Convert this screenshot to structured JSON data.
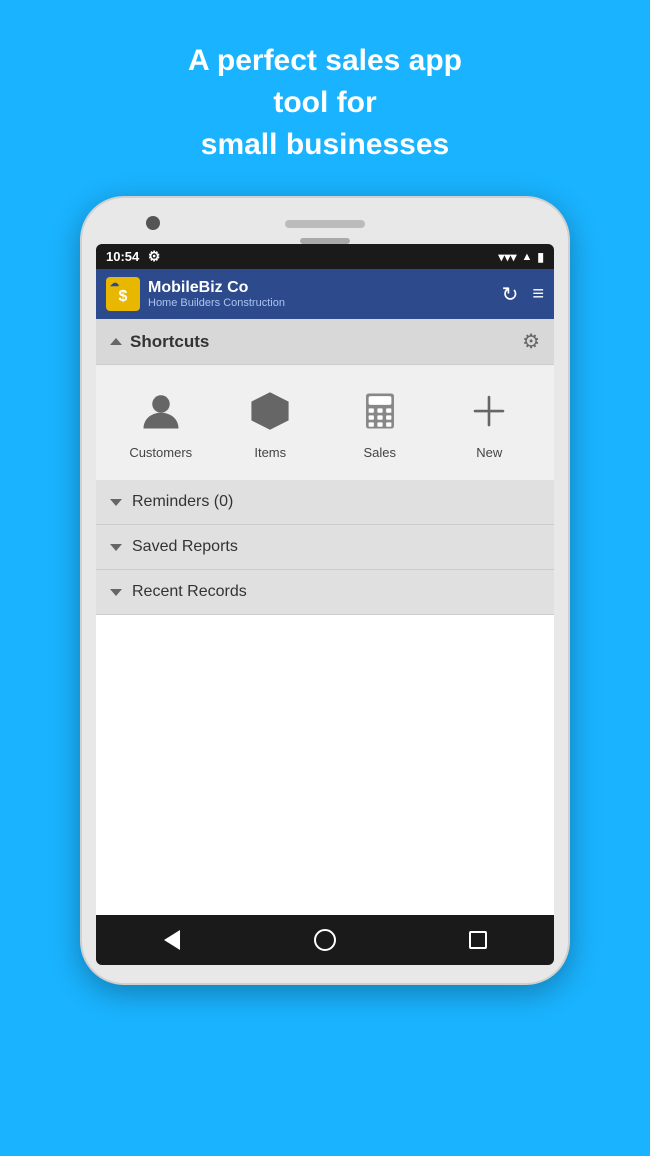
{
  "tagline": {
    "line1": "A perfect sales app",
    "line2": "tool for",
    "line3": "small businesses"
  },
  "statusBar": {
    "time": "10:54",
    "settingsIcon": "settings-icon"
  },
  "appBar": {
    "appName": "MobileBiz Co",
    "appSubtitle": "Home Builders Construction",
    "refreshIcon": "refresh-icon",
    "menuIcon": "menu-icon"
  },
  "shortcuts": {
    "title": "Shortcuts",
    "items": [
      {
        "label": "Customers",
        "icon": "person-icon"
      },
      {
        "label": "Items",
        "icon": "box-icon"
      },
      {
        "label": "Sales",
        "icon": "calculator-icon"
      },
      {
        "label": "New",
        "icon": "plus-icon"
      }
    ]
  },
  "sections": [
    {
      "label": "Reminders (0)"
    },
    {
      "label": "Saved Reports"
    },
    {
      "label": "Recent Records"
    }
  ],
  "bottomNav": {
    "backLabel": "back",
    "homeLabel": "home",
    "recentsLabel": "recents"
  }
}
